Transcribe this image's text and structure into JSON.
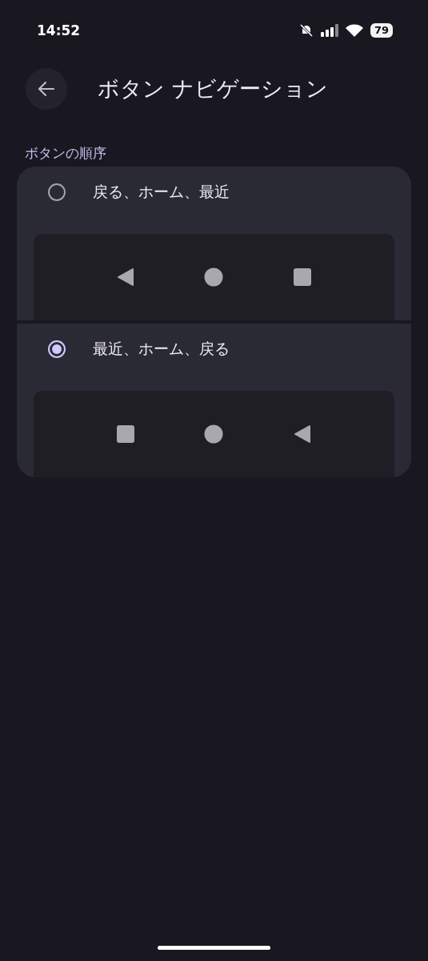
{
  "status_bar": {
    "time": "14:52",
    "battery": "79"
  },
  "header": {
    "title": "ボタン ナビゲーション"
  },
  "section": {
    "label": "ボタンの順序"
  },
  "options": [
    {
      "label": "戻る、ホーム、最近",
      "selected": false,
      "buttons": [
        {
          "kind": "back"
        },
        {
          "kind": "home"
        },
        {
          "kind": "recents"
        }
      ]
    },
    {
      "label": "最近、ホーム、戻る",
      "selected": true,
      "buttons": [
        {
          "kind": "recents"
        },
        {
          "kind": "home"
        },
        {
          "kind": "back"
        }
      ]
    }
  ]
}
